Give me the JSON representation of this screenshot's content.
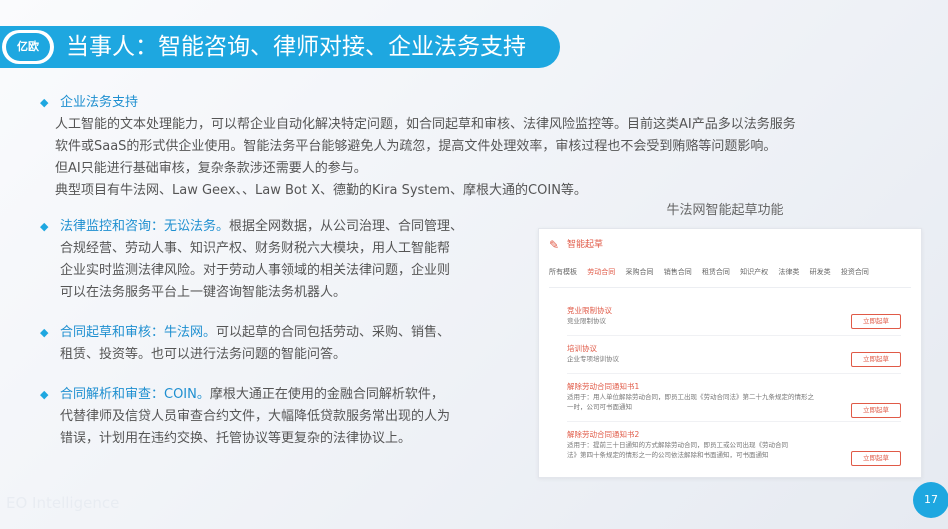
{
  "header": {
    "logo_text": "亿欧",
    "title": "当事人：智能咨询、律师对接、企业法务支持"
  },
  "sections": [
    {
      "heading": "企业法务支持",
      "lines": [
        "人工智能的文本处理能力，可以帮企业自动化解决特定问题，如合同起草和审核、法律风险监控等。目前这类AI产品多以法务服务",
        "软件或SaaS的形式供企业使用。智能法务平台能够避免人为疏忽，提高文件处理效率，审核过程也不会受到贿赂等问题影响。",
        "但AI只能进行基础审核，复杂条款涉还需要人的参与。",
        "典型项目有牛法网、Law Geex、、Law Bot X、德勤的Kira System、摩根大通的COIN等。"
      ]
    },
    {
      "lead": "法律监控和咨询：无讼法务。",
      "lines": [
        "根据全网数据，从公司治理、合同管理、",
        "合规经营、劳动人事、知识产权、财务财税六大模块，用人工智能帮",
        "企业实时监测法律风险。对于劳动人事领域的相关法律问题，企业则",
        "可以在法务服务平台上一键咨询智能法务机器人。"
      ]
    },
    {
      "lead": "合同起草和审核：牛法网。",
      "lines": [
        "可以起草的合同包括劳动、采购、销售、",
        "租赁、投资等。也可以进行法务问题的智能问答。"
      ]
    },
    {
      "lead": "合同解析和审查：COIN。",
      "lines": [
        "摩根大通正在使用的金融合同解析软件，",
        "代替律师及信贷人员审查合约文件，大幅降低贷款服务常出现的人为",
        "错误，计划用在违约交换、托管协议等更复杂的法律协议上。"
      ]
    }
  ],
  "figure": {
    "caption": "牛法网智能起草功能",
    "panel_title": "智能起草",
    "tabs": [
      "所有模板",
      "劳动合同",
      "采购合同",
      "销售合同",
      "租赁合同",
      "知识产权",
      "法律类",
      "研发类",
      "投资合同"
    ],
    "active_tab": 1,
    "templates": [
      {
        "title": "竞业限制协议",
        "desc": [
          "竞业限制协议"
        ],
        "button": "立即起草"
      },
      {
        "title": "培训协议",
        "desc": [
          "企业专项培训协议"
        ],
        "button": "立即起草"
      },
      {
        "title": "解除劳动合同通知书1",
        "desc": [
          "适用于：用人单位解除劳动合同，即员工出现《劳动合同法》第二十九条规定的情形之",
          "一时，公司可书面通知"
        ],
        "button": "立即起草"
      },
      {
        "title": "解除劳动合同通知书2",
        "desc": [
          "适用于：提前三十日通知的方式解除劳动合同，即员工或公司出现《劳动合同",
          "法》第四十条规定的情形之一的公司依法解除和书面通知，可书面通知"
        ],
        "button": "立即起草"
      }
    ]
  },
  "footer": {
    "brand": "EO Intelligence",
    "page_number": "17"
  },
  "colors": {
    "accent": "#1ea7e0",
    "heading_blue": "#1e8fd0",
    "panel_red": "#e05a47"
  }
}
